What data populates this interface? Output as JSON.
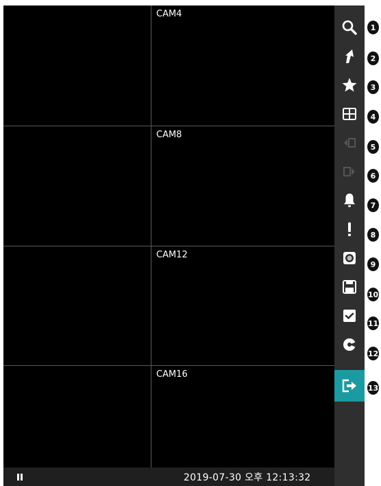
{
  "cameras": [
    {
      "label": ""
    },
    {
      "label": "CAM4"
    },
    {
      "label": ""
    },
    {
      "label": "CAM8"
    },
    {
      "label": ""
    },
    {
      "label": "CAM12"
    },
    {
      "label": ""
    },
    {
      "label": "CAM16"
    }
  ],
  "status_bar": {
    "datetime": "2019-07-30 오후 12:13:32",
    "playback_icon": "pause-icon"
  },
  "toolbar": {
    "buttons": [
      {
        "icon": "search-icon",
        "number": "1"
      },
      {
        "icon": "quick-access-arrow-icon",
        "number": "2"
      },
      {
        "icon": "favorite-star-icon",
        "number": "3"
      },
      {
        "icon": "split-layout-icon",
        "number": "4"
      },
      {
        "icon": "previous-group-icon",
        "number": "5"
      },
      {
        "icon": "next-group-icon",
        "number": "6"
      },
      {
        "icon": "alarm-bell-icon",
        "number": "7"
      },
      {
        "icon": "event-alert-icon",
        "number": "8"
      },
      {
        "icon": "record-icon",
        "number": "9"
      },
      {
        "icon": "save-floppy-icon",
        "number": "10"
      },
      {
        "icon": "checkbox-icon",
        "number": "11"
      },
      {
        "icon": "rotate-icon",
        "number": "12"
      },
      {
        "icon": "exit-icon",
        "number": "13"
      }
    ],
    "active_color": "#1c9aa1",
    "background_color": "#2f2f2f"
  }
}
